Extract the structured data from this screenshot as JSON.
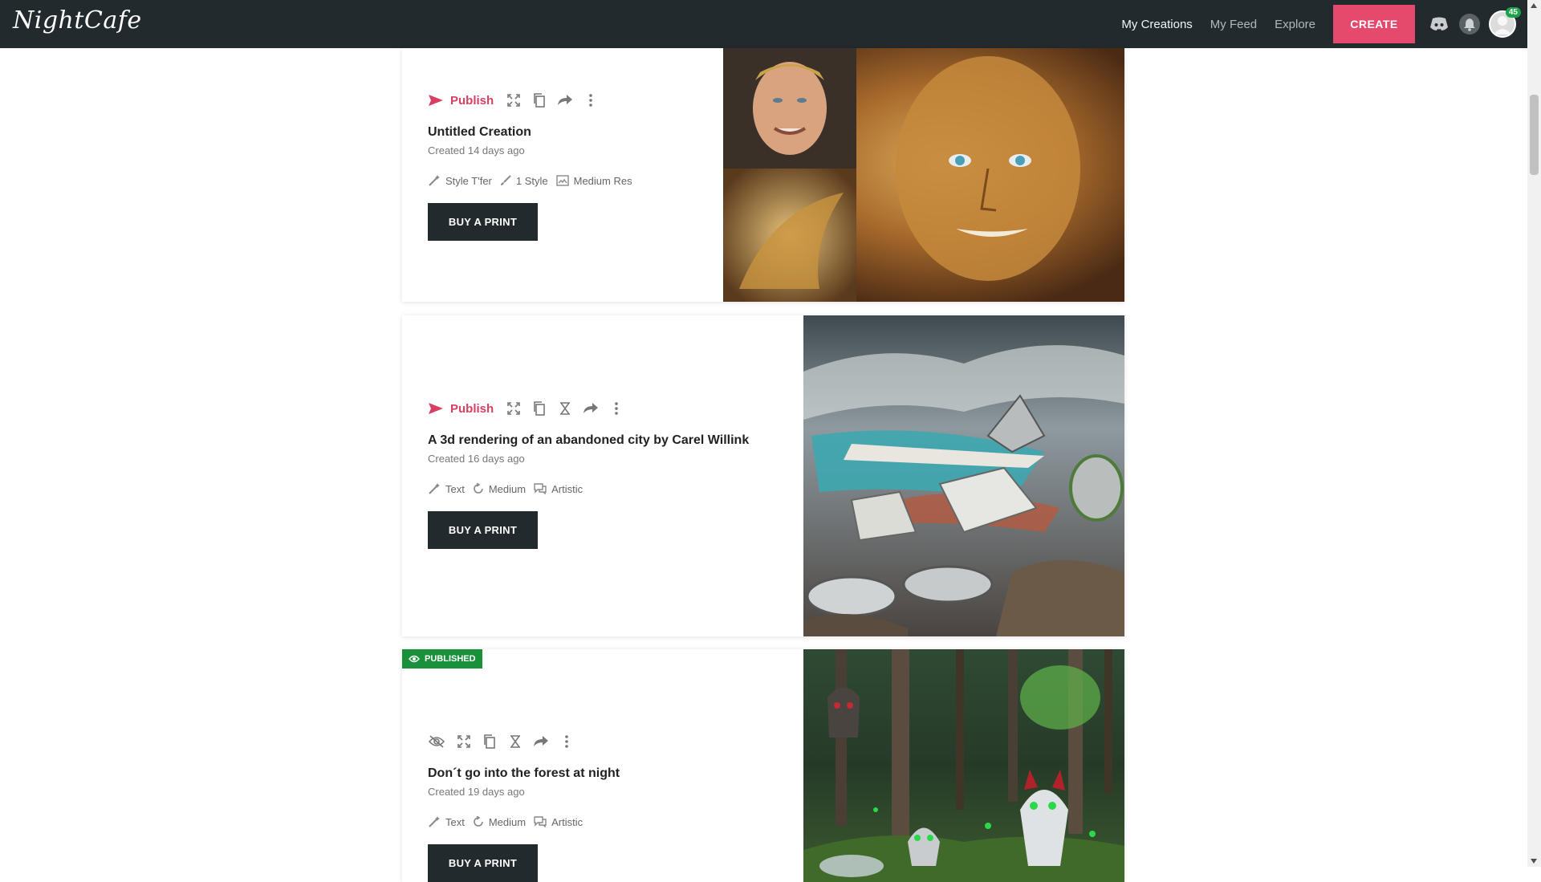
{
  "app": {
    "logo": "NightCafe"
  },
  "nav": {
    "my_creations": "My Creations",
    "my_feed": "My Feed",
    "explore": "Explore",
    "create": "CREATE",
    "notifications_count": "45"
  },
  "icons": [
    "discord-icon",
    "bell-icon",
    "avatar",
    "send-icon",
    "expand-icon",
    "copy-icon",
    "hourglass-icon",
    "share-icon",
    "more-vertical-icon",
    "hidden-eye-icon",
    "eye-icon",
    "wand-icon",
    "brush-icon",
    "image-res-icon",
    "cycle-icon",
    "chat-icon"
  ],
  "colors": {
    "topbar": "#232a2e",
    "accent": "#e5496c",
    "publish": "#d83f61",
    "published_badge": "#18913a",
    "button_dark": "#232a2e"
  },
  "cards": [
    {
      "publish_label": "Publish",
      "title": "Untitled Creation",
      "created": "Created 14 days ago",
      "meta": [
        "Style T'fer",
        "1 Style",
        "Medium Res"
      ],
      "buy_label": "BUY A PRINT"
    },
    {
      "publish_label": "Publish",
      "title": "A 3d rendering of an abandoned city by Carel Willink",
      "created": "Created 16 days ago",
      "meta": [
        "Text",
        "Medium",
        "Artistic"
      ],
      "buy_label": "BUY A PRINT"
    },
    {
      "badge": "PUBLISHED",
      "title": "Don´t go into the forest at night",
      "created": "Created 19 days ago",
      "meta": [
        "Text",
        "Medium",
        "Artistic"
      ],
      "buy_label": "BUY A PRINT"
    }
  ]
}
